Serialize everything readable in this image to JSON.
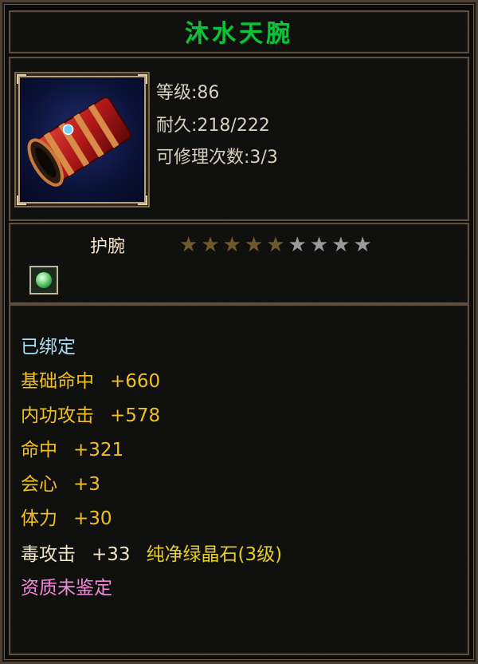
{
  "item": {
    "name": "沐水天腕",
    "level_line": "等级:86",
    "durability_line": "耐久:218/222",
    "repair_line": "可修理次数:3/3",
    "type": "护腕",
    "stars_filled": 5,
    "stars_total": 9,
    "icon": "red-bracer-icon",
    "gem_slot_icon": "green-gem-icon"
  },
  "stats": {
    "bound": "已绑定",
    "base_hit_label": "基础命中",
    "base_hit_value": "+660",
    "internal_attack_label": "内功攻击",
    "internal_attack_value": "+578",
    "hit_label": "命中",
    "hit_value": "+321",
    "crit_label": "会心",
    "crit_value": "+3",
    "stamina_label": "体力",
    "stamina_value": "+30",
    "poison_attack_label": "毒攻击",
    "poison_attack_value": "+33",
    "gem_text": "纯净绿晶石(3级)",
    "quality": "资质未鉴定"
  },
  "colors": {
    "title": "#0fc23a",
    "bound": "#a8dcef",
    "base_stat": "#f0e6c6",
    "bonus_stat": "#f0c020",
    "gem": "#e8d020",
    "quality": "#f08ad8",
    "info": "#d8d0bf"
  }
}
